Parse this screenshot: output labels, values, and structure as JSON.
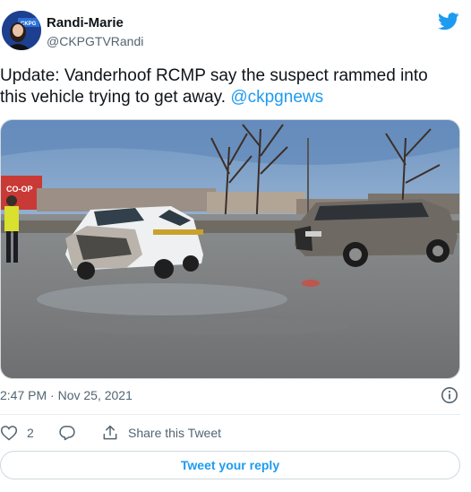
{
  "author": {
    "display_name": "Randi-Marie",
    "handle": "@CKPGTVRandi"
  },
  "tweet": {
    "text": "Update: Vanderhoof RCMP say the suspect rammed into\nthis vehicle trying to get away. ",
    "mention": "@ckpgnews",
    "timestamp": "2:47 PM · Nov 25, 2021"
  },
  "media": {
    "sign_text": "CO-OP"
  },
  "actions": {
    "like_count": "2",
    "share_label": "Share this Tweet",
    "reply_button_label": "Tweet your reply"
  },
  "icons": {
    "brand": "twitter-bird-icon",
    "info": "info-icon",
    "like": "heart-icon",
    "reply": "reply-bubble-icon",
    "share": "share-icon"
  },
  "colors": {
    "accent": "#1d9bf0",
    "text": "#0f1419",
    "secondary": "#536471",
    "border": "#cfd9de"
  }
}
